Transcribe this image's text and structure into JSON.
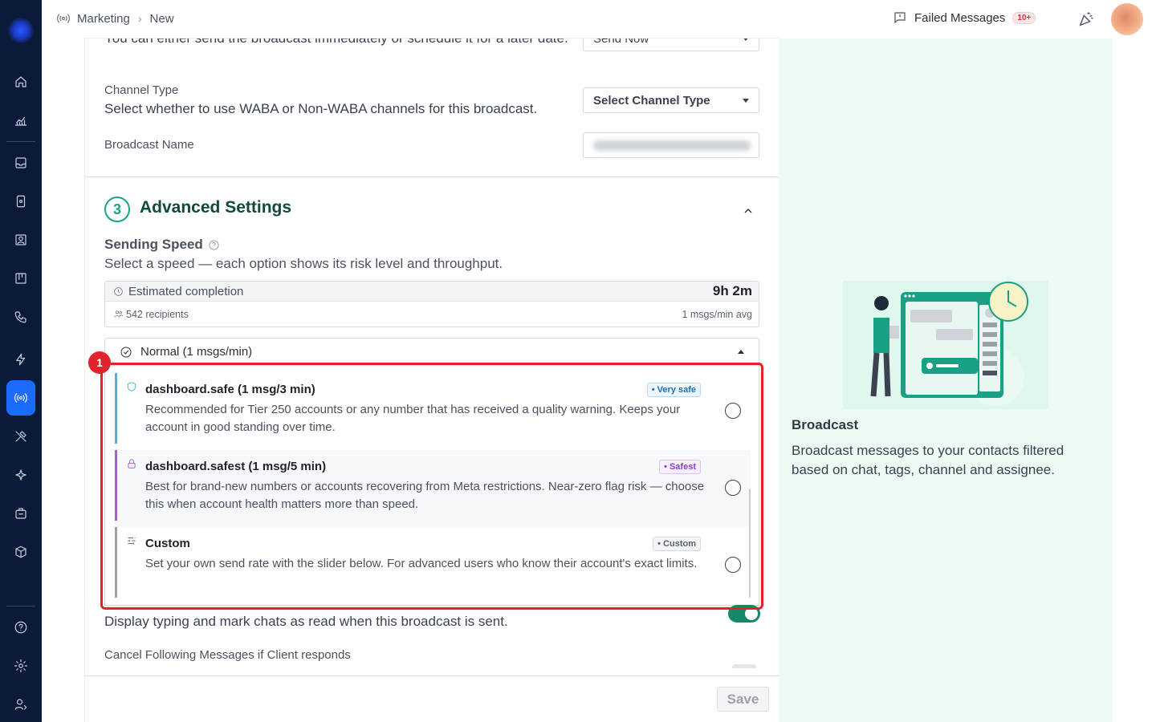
{
  "breadcrumb": {
    "section": "Marketing",
    "page": "New"
  },
  "topbar": {
    "failed_label": "Failed Messages",
    "failed_count": "10+"
  },
  "form": {
    "schedule_desc": "You can either send the broadcast immediately or schedule it for a later date.",
    "schedule_value": "Send Now",
    "channel_label": "Channel Type",
    "channel_desc": "Select whether to use WABA or Non-WABA channels for this broadcast.",
    "channel_value": "Select Channel Type",
    "name_label": "Broadcast Name"
  },
  "advanced": {
    "number": "3",
    "title": "Advanced Settings",
    "speed_title": "Sending Speed",
    "speed_desc": "Select a speed — each option shows its risk level and throughput.",
    "est_label": "Estimated completion",
    "est_value": "9h 2m",
    "recipients": "542 recipients",
    "avg": "1 msgs/min avg",
    "speed_selected": "Normal (1 msgs/min)",
    "options": [
      {
        "title": "dashboard.safe (1 msg/3 min)",
        "tag": "• Very safe",
        "desc": "Recommended for Tier 250 accounts or any number that has received a quality warning. Keeps your account in good standing over time.",
        "icon": "shield-icon",
        "color": "#4bb3d9",
        "tag_color": "#1d6fb8"
      },
      {
        "title": "dashboard.safest (1 msg/5 min)",
        "tag": "• Safest",
        "desc": "Best for brand-new numbers or accounts recovering from Meta restrictions. Near-zero flag risk — choose this when account health matters more than speed.",
        "icon": "lock-icon",
        "color": "#a35be0",
        "tag_color": "#8a3fd1"
      },
      {
        "title": "Custom",
        "tag": "• Custom",
        "desc": "Set your own send rate with the slider below. For advanced users who know their account's exact limits.",
        "icon": "sliders-icon",
        "color": "#9ca1a9",
        "tag_color": "#5b6170"
      }
    ],
    "typing_desc": "Display typing and mark chats as read when this broadcast is sent.",
    "cancel_label": "Cancel Following Messages if Client responds"
  },
  "highlight_number": "1",
  "footer": {
    "save_label": "Save"
  },
  "side": {
    "title": "Broadcast",
    "desc": "Broadcast messages to your contacts filtered based on chat, tags, channel and assignee."
  }
}
